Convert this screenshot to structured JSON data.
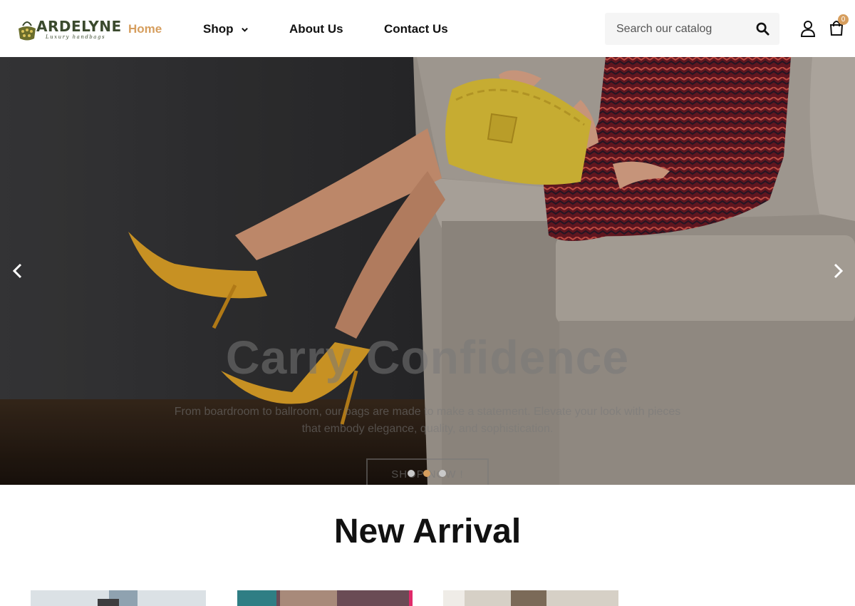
{
  "brand": {
    "name": "ARDELYNE",
    "tagline": "Luxury handbags"
  },
  "nav": {
    "items": [
      {
        "label": "Home",
        "active": true
      },
      {
        "label": "Shop",
        "has_dropdown": true
      },
      {
        "label": "About Us"
      },
      {
        "label": "Contact Us"
      }
    ]
  },
  "search": {
    "placeholder": "Search our catalog",
    "value": ""
  },
  "cart": {
    "count": "0"
  },
  "hero": {
    "title": "Carry Confidence",
    "subtitle": "From boardroom to ballroom, our bags are made to make a statement. Elevate your look with pieces that embody elegance, quality, and sophistication.",
    "cta_label": "SHOP NOW !",
    "slides_total": 3,
    "active_slide": 2
  },
  "new_arrival": {
    "title": "New Arrival"
  },
  "colors": {
    "accent": "#d69e5e",
    "text": "#111111",
    "logo": "#3b4a2e"
  },
  "icons": [
    "logo-bag-icon",
    "chevron-down-icon",
    "search-icon",
    "user-icon",
    "cart-icon",
    "chevron-left-icon",
    "chevron-right-icon"
  ]
}
